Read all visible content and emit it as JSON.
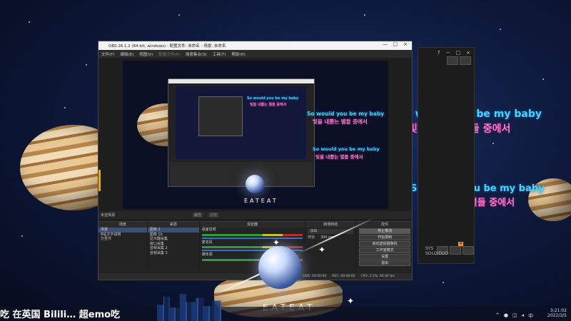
{
  "lyrics": {
    "line1_en": "So would you be my baby",
    "line1_ko": "빛을 내뿜는 별들 중에서",
    "line2_en": "So would you be my baby",
    "line2_ko": "빛을 내뿜는 별들 중에서"
  },
  "side_panel": {
    "buttons": [
      "?",
      "−",
      "□",
      "×"
    ],
    "badge_text": "4",
    "sys_text": "SYS\nSOLO/DUO"
  },
  "obs": {
    "title": "OBS 26.1.1 (64-bit, windows) - 配置文件: 未命名 - 场景: 未命名",
    "window_buttons": [
      "—",
      "□",
      "×"
    ],
    "menu": [
      "文件(F)",
      "编辑(E)",
      "视图(V)",
      "配置文件(P)",
      "场景集合(S)",
      "工具(T)",
      "帮助(H)"
    ],
    "preview_lyrics": {
      "en": "So would you be my baby",
      "ko": "빛을 내뿜는 별들 중에서",
      "en2": "So would you be my baby",
      "ko2": "빛을 내뿜는 별들 중에서"
    },
    "scene_bar_label": "未选择源",
    "scene_bar_props": "属性",
    "scene_bar_filters": "滤镜",
    "docks": {
      "scenes_header": "场景",
      "scenes": [
        "场景",
        "B站文字说明",
        "万圣节"
      ],
      "sources_header": "来源",
      "sources": [
        "图像 2",
        "图像 1b",
        "显示器采集",
        "窗口采集",
        "音频采集 2",
        "音频采集 3"
      ],
      "mixer_header": "混音器",
      "mixer_channels": [
        "桌面音频",
        "麦克风",
        "媒体源"
      ],
      "transitions_header": "转场特效",
      "transition_value": "淡出",
      "duration_label": "时长",
      "duration_value": "300 ms",
      "controls_header": "控件",
      "controls": [
        "停止推流",
        "开始录制",
        "启动虚拟摄像机",
        "工作室模式",
        "设置",
        "退出"
      ],
      "footer_add": "+ − ∧ ∨"
    },
    "status": {
      "live": "LIVE: 00:00:00",
      "rec": "REC: 00:00:00",
      "cpu": "CPU: 2.5%, 60.00 fps"
    }
  },
  "overlay": {
    "eateat_top": "EATEAT",
    "eateat_bottom": "EATEAT"
  },
  "taskbar": {
    "danmaku": "吃  在英国  Bilili… 超emo吃",
    "time": "3:21:02",
    "date": "2022/3/5"
  },
  "colors": {
    "lyric_en": "#3fd6ff",
    "lyric_ko": "#ff7bd3",
    "obs_bg": "#1e1e1e",
    "active_control": "#595959"
  }
}
